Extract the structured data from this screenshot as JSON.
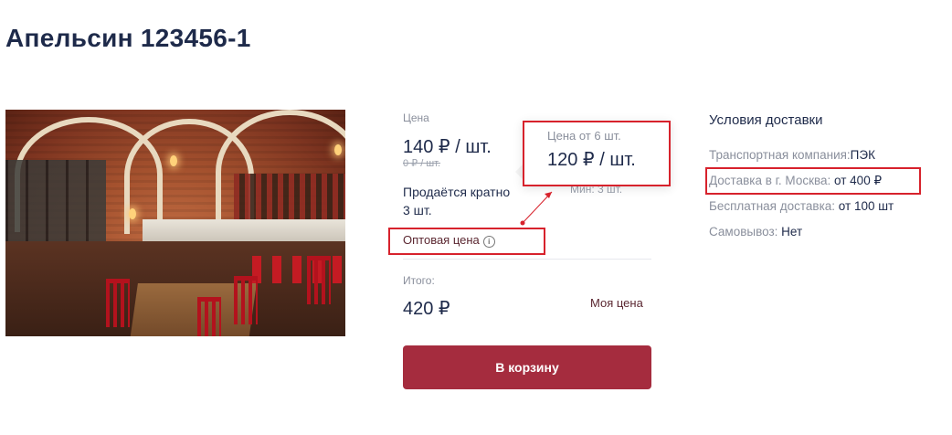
{
  "product": {
    "title": "Апельсин 123456-1"
  },
  "pricing": {
    "price_label": "Цена",
    "price": "140 ₽ / шт.",
    "old_price": "0 ₽ / шт.",
    "multiple_note": "Продаётся кратно 3 шт.",
    "min_qty": "Мин: 3 шт.",
    "wholesale_link": "Оптовая цена",
    "info_icon": "info-icon",
    "total_label": "Итого:",
    "total_value": "420 ₽",
    "my_price_link": "Моя цена",
    "cart_button": "В корзину"
  },
  "tooltip": {
    "label": "Цена от 6 шт.",
    "price": "120 ₽ / шт."
  },
  "delivery": {
    "title": "Условия доставки",
    "rows": [
      {
        "key": "Транспортная компания:",
        "value": "ПЭК"
      },
      {
        "key": "Доставка в г. Москва:",
        "value": " от 400 ₽"
      },
      {
        "key": "Бесплатная доставка:",
        "value": " от 100 шт"
      },
      {
        "key": "Самовывоз:",
        "value": " Нет"
      }
    ]
  },
  "colors": {
    "accent": "#a52c3e",
    "annotation": "#d7222c",
    "text_dark": "#1e2a4a",
    "text_muted": "#8a8f9c"
  }
}
